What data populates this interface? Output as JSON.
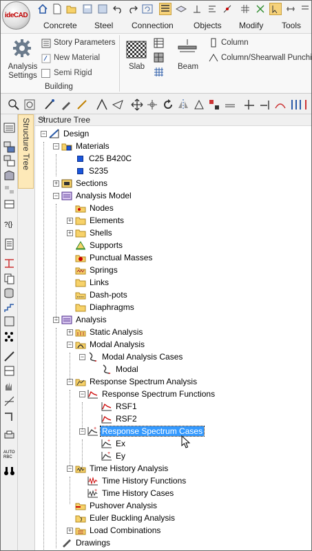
{
  "app": {
    "logo_text": "ideCAD"
  },
  "ribbon_tabs": [
    "Concrete",
    "Steel",
    "Connection",
    "Objects",
    "Modify",
    "Tools"
  ],
  "ribbon": {
    "analysis_settings": "Analysis Settings",
    "story_parameters": "Story Parameters",
    "new_material": "New Material",
    "semi_rigid": "Semi Rigid",
    "group_building": "Building",
    "slab": "Slab",
    "beam": "Beam",
    "column": "Column",
    "column_shearwall": "Column/Shearwall Punchi"
  },
  "vertical_tab": "Structure Tree",
  "panel_title": "Structure Tree",
  "tree": {
    "design": "Design",
    "materials": "Materials",
    "c25": "C25 B420C",
    "s235": "S235",
    "sections": "Sections",
    "analysis_model": "Analysis Model",
    "nodes": "Nodes",
    "elements": "Elements",
    "shells": "Shells",
    "supports": "Supports",
    "punctual_masses": "Punctual Masses",
    "springs": "Springs",
    "links": "Links",
    "dashpots": "Dash-pots",
    "diaphragms": "Diaphragms",
    "analysis": "Analysis",
    "static_analysis": "Static Analysis",
    "modal_analysis": "Modal Analysis",
    "modal_analysis_cases": "Modal Analysis Cases",
    "modal": "Modal",
    "response_spectrum_analysis": "Response Spectrum Analysis",
    "response_spectrum_functions": "Response Spectrum Functions",
    "rsf1": "RSF1",
    "rsf2": "RSF2",
    "response_spectrum_cases": "Response Spectrum Cases",
    "ex": "Ex",
    "ey": "Ey",
    "time_history_analysis": "Time History Analysis",
    "time_history_functions": "Time History Functions",
    "time_history_cases": "Time History Cases",
    "pushover_analysis": "Pushover Analysis",
    "euler_buckling_analysis": "Euler Buckling Analysis",
    "load_combinations": "Load Combinations",
    "drawings": "Drawings"
  }
}
